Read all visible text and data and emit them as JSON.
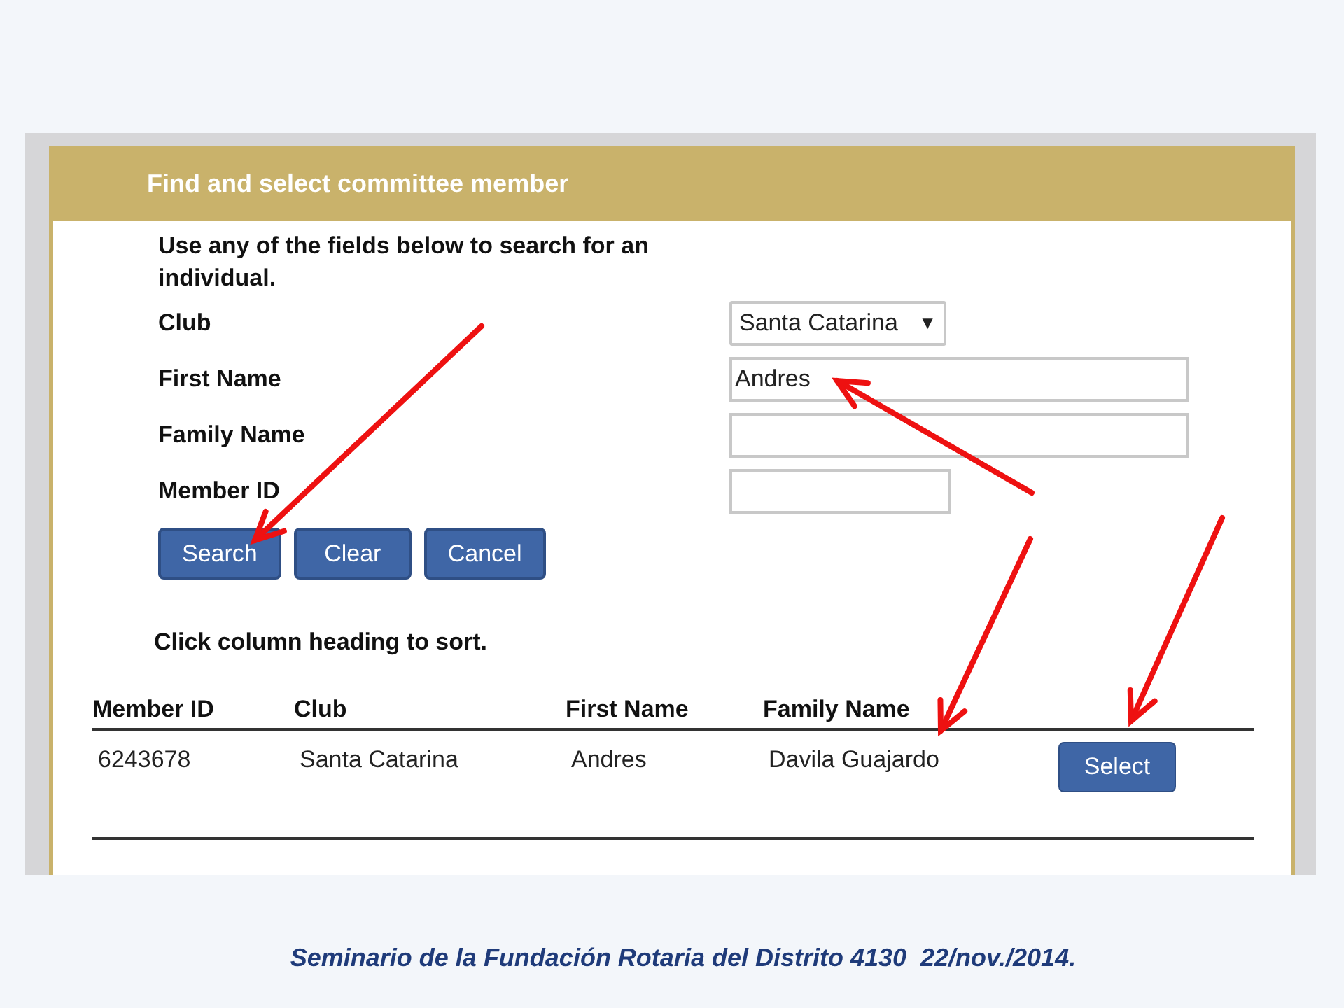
{
  "dialog": {
    "title": "Find and select committee member",
    "intro": "Use any of the fields below to search for an individual.",
    "fields": [
      {
        "kind": "select",
        "label": "Club",
        "value": "Santa Catarina",
        "caret": "▼"
      },
      {
        "kind": "text",
        "label": "First Name",
        "value": "Andres"
      },
      {
        "kind": "text",
        "label": "Family Name"
      },
      {
        "kind": "short",
        "label": "Member ID"
      }
    ],
    "buttons": [
      "Search",
      "Clear",
      "Cancel"
    ],
    "sort_hint": "Click column heading to sort.",
    "table": {
      "columns": [
        "Member ID",
        "Club",
        "First Name",
        "Family Name"
      ],
      "rows": [
        {
          "cells": [
            "6243678",
            "Santa Catarina",
            "Andres",
            "Davila Guajardo"
          ],
          "action": "Select"
        }
      ]
    }
  },
  "footer": "Seminario de la Fundación Rotaria del Distrito 4130  22/nov./2014."
}
